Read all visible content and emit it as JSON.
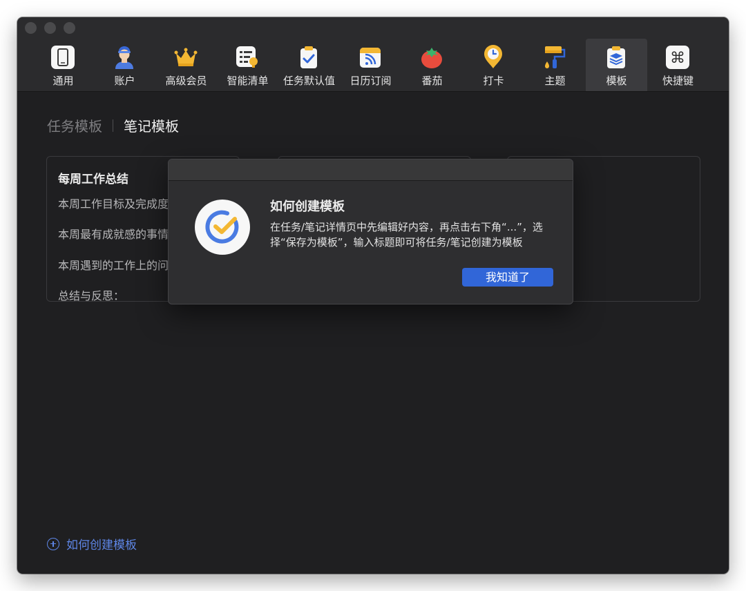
{
  "toolbar": {
    "tabs": [
      {
        "label": "通用",
        "icon": "phone-device-icon"
      },
      {
        "label": "账户",
        "icon": "user-avatar-icon"
      },
      {
        "label": "高级会员",
        "icon": "crown-icon"
      },
      {
        "label": "智能清单",
        "icon": "smart-list-icon"
      },
      {
        "label": "任务默认值",
        "icon": "clipboard-check-icon"
      },
      {
        "label": "日历订阅",
        "icon": "calendar-rss-icon"
      },
      {
        "label": "番茄",
        "icon": "tomato-icon"
      },
      {
        "label": "打卡",
        "icon": "clock-pin-icon"
      },
      {
        "label": "主题",
        "icon": "paint-roller-icon"
      },
      {
        "label": "模板",
        "icon": "template-layers-icon"
      },
      {
        "label": "快捷键",
        "icon": "command-key-icon"
      }
    ],
    "active_index": 9
  },
  "segments": {
    "task_templates": "任务模板",
    "note_templates": "笔记模板",
    "active": "note_templates"
  },
  "cards": [
    {
      "title": "每周工作总结",
      "lines": [
        "本周工作目标及完成度：",
        "本周最有成就感的事情：",
        "本周遇到的工作上的问题：",
        "总结与反思："
      ]
    }
  ],
  "footer": {
    "how_to_create": "如何创建模板"
  },
  "dialog": {
    "title": "如何创建模板",
    "body": "在任务/笔记详情页中先编辑好内容，再点击右下角“...”，选择“保存为模板”，输入标题即可将任务/笔记创建为模板",
    "button": "我知道了",
    "logo_icon": "ticktick-check-logo-icon"
  },
  "colors": {
    "accent": "#3166d8",
    "link": "#5e86e6",
    "background": "#1f1f21",
    "toolbar": "#2b2b2d"
  }
}
